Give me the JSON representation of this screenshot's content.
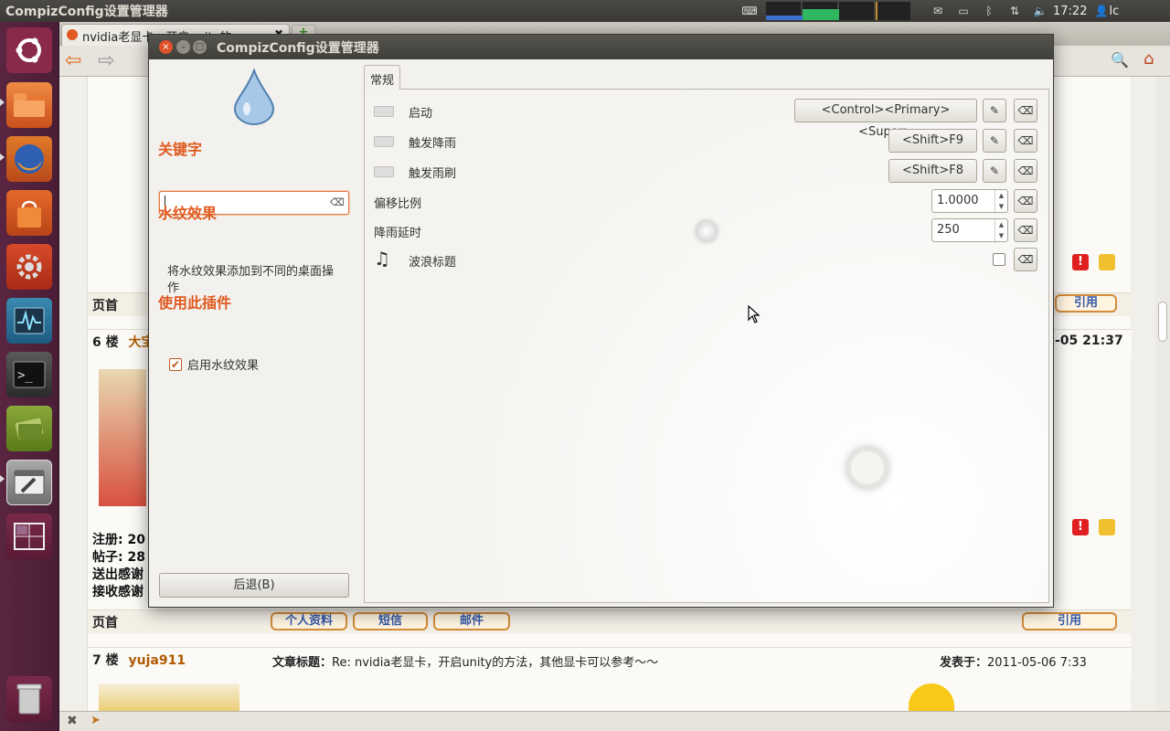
{
  "top_panel": {
    "app_title": "CompizConfig设置管理器",
    "clock": "17:22",
    "user": "lc"
  },
  "launcher": {
    "items": [
      "ubuntu-logo",
      "home-folder",
      "firefox",
      "software-center",
      "system-settings",
      "system-monitor",
      "terminal",
      "books",
      "compizconfig",
      "workspace-switcher",
      "trash"
    ]
  },
  "browser": {
    "tab_title": "nvidia老显卡，开启unity的",
    "rows": {
      "page_top": "页首",
      "floor6_num": "6 楼",
      "floor6_name": "大宝",
      "floor6_date": "-05 21:37",
      "floor7_num": "7 楼",
      "floor7_name": "yuja911",
      "floor7_title_label": "文章标题：",
      "floor7_title": "Re: nvidia老显卡，开启unity的方法，其他显卡可以参考～～",
      "floor7_date_label": "发表于：",
      "floor7_date": "2011-05-06 7:33",
      "profile_1": "注册: 20",
      "profile_2": "帖子: 28",
      "profile_3": "送出感谢",
      "profile_4": "接收感谢"
    },
    "buttons": {
      "profile": "个人资料",
      "pm": "短信",
      "mail": "邮件",
      "quote": "引用"
    }
  },
  "dialog": {
    "title": "CompizConfig设置管理器",
    "sidebar": {
      "filter_heading": "关键字",
      "filter_value": "",
      "plugin_heading": "水纹效果",
      "plugin_desc": "将水纹效果添加到不同的桌面操作",
      "use_heading": "使用此插件",
      "enable_label": "启用水纹效果",
      "enable_checked": true,
      "back_button": "后退(B)"
    },
    "tabs": [
      "常规"
    ],
    "settings": [
      {
        "label": "启动",
        "value": "<Control><Primary><Super>"
      },
      {
        "label": "触发降雨",
        "value": "<Shift>F9"
      },
      {
        "label": "触发雨刷",
        "value": "<Shift>F8"
      },
      {
        "label": "偏移比例",
        "value": "1.0000"
      },
      {
        "label": "降雨延时",
        "value": "250"
      },
      {
        "label": "波浪标题",
        "value": false
      }
    ]
  }
}
